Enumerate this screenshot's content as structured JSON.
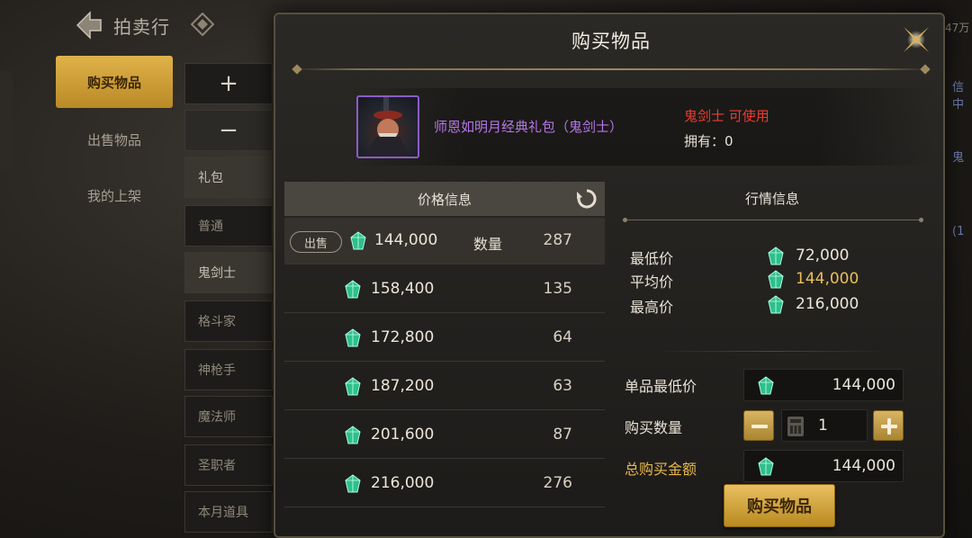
{
  "auction": {
    "title": "拍卖行",
    "corner_text": "47万",
    "tabs": [
      "购买物品",
      "出售物品",
      "我的上架"
    ],
    "categories": [
      "礼包",
      "普通",
      "鬼剑士",
      "格斗家",
      "神枪手",
      "魔法师",
      "圣职者",
      "本月道具"
    ],
    "right_edge": [
      "信中",
      "鬼",
      "(1"
    ]
  },
  "modal": {
    "title": "购买物品",
    "item": {
      "name": "师恩如明月经典礼包（鬼剑士）",
      "usable": "鬼剑士 可使用",
      "owned": "拥有：0"
    },
    "price_info": {
      "header": "价格信息",
      "sell_badge": "出售",
      "qty_label": "数量",
      "rows": [
        {
          "price": "144,000",
          "qty": "287"
        },
        {
          "price": "158,400",
          "qty": "135"
        },
        {
          "price": "172,800",
          "qty": "64"
        },
        {
          "price": "187,200",
          "qty": "63"
        },
        {
          "price": "201,600",
          "qty": "87"
        },
        {
          "price": "216,000",
          "qty": "276"
        }
      ]
    },
    "market": {
      "header": "行情信息",
      "min_label": "最低价",
      "min": "72,000",
      "avg_label": "平均价",
      "avg": "144,000",
      "max_label": "最高价",
      "max": "216,000"
    },
    "form": {
      "unit_min_label": "单品最低价",
      "unit_min": "144,000",
      "qty_label": "购买数量",
      "qty": "1",
      "total_label": "总购买金额",
      "total": "144,000"
    },
    "buy_label": "购买物品"
  },
  "colors": {
    "gold": "#e7b84a",
    "purple_item": "#b676e6",
    "red_class": "#f03a2e",
    "gem": "#3fd6a0"
  }
}
